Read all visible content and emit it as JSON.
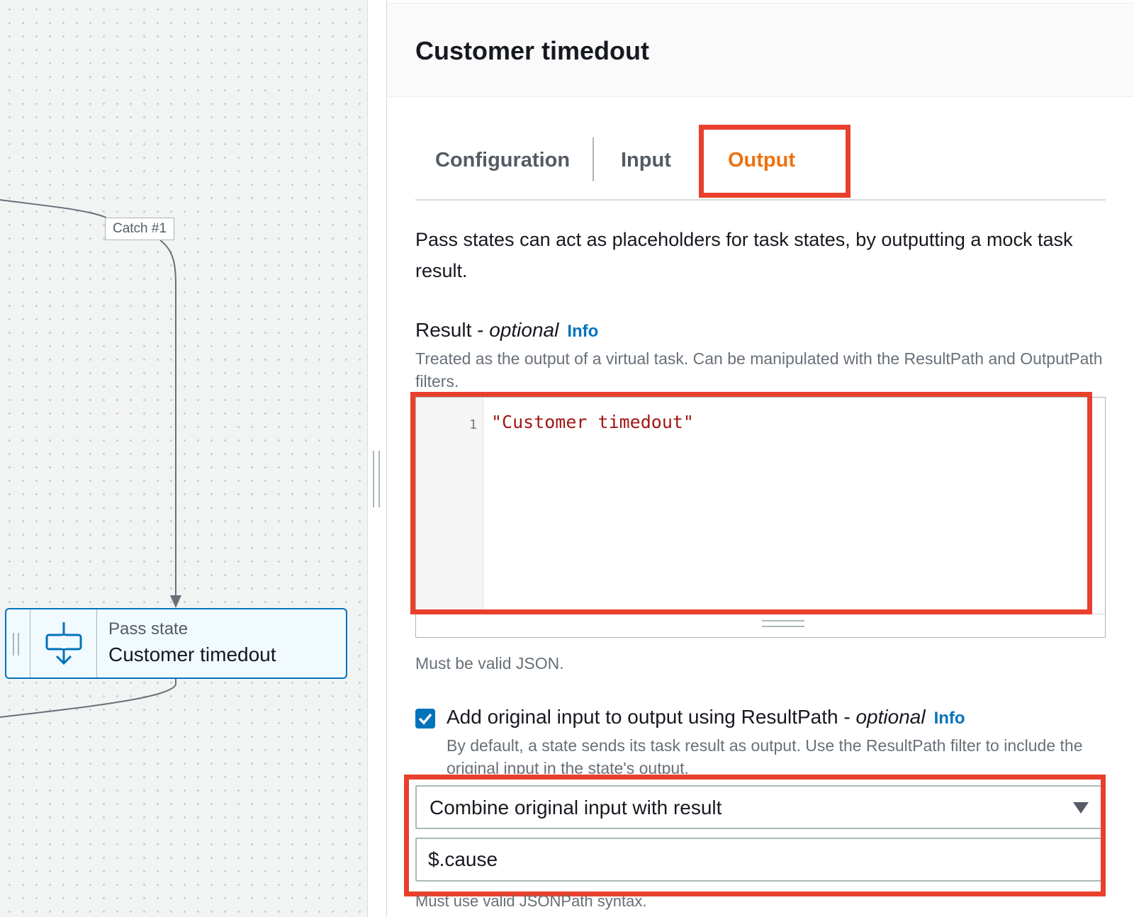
{
  "canvas": {
    "catch_label": "Catch #1",
    "node": {
      "kind": "Pass state",
      "name": "Customer timedout"
    }
  },
  "panel": {
    "title": "Customer timedout",
    "tabs": [
      {
        "label": "Configuration",
        "active": false
      },
      {
        "label": "Input",
        "active": false
      },
      {
        "label": "Output",
        "active": true
      }
    ],
    "description": "Pass states can act as placeholders for task states, by outputting a mock task result.",
    "result": {
      "label": "Result - ",
      "optional": "optional",
      "info": "Info",
      "hint": "Treated as the output of a virtual task. Can be manipulated with the ResultPath and OutputPath filters.",
      "line_number": "1",
      "code": "\"Customer timedout\"",
      "validation": "Must be valid JSON."
    },
    "result_path": {
      "checked": true,
      "label": "Add original input to output using ResultPath - ",
      "optional": "optional",
      "info": "Info",
      "hint": "By default, a state sends its task result as output. Use the ResultPath filter to include the original input in the state's output.",
      "select_value": "Combine original input with result",
      "input_value": "$.cause",
      "validation": "Must use valid JSONPath syntax."
    }
  },
  "colors": {
    "accent_tab": "#ec7211",
    "link": "#0073bb",
    "highlight": "#e8402c",
    "code_string": "#a31515"
  },
  "icons": {
    "node_icon": "pass-state-icon",
    "checkbox": "checkmark-icon",
    "select_caret": "caret-down-icon"
  }
}
